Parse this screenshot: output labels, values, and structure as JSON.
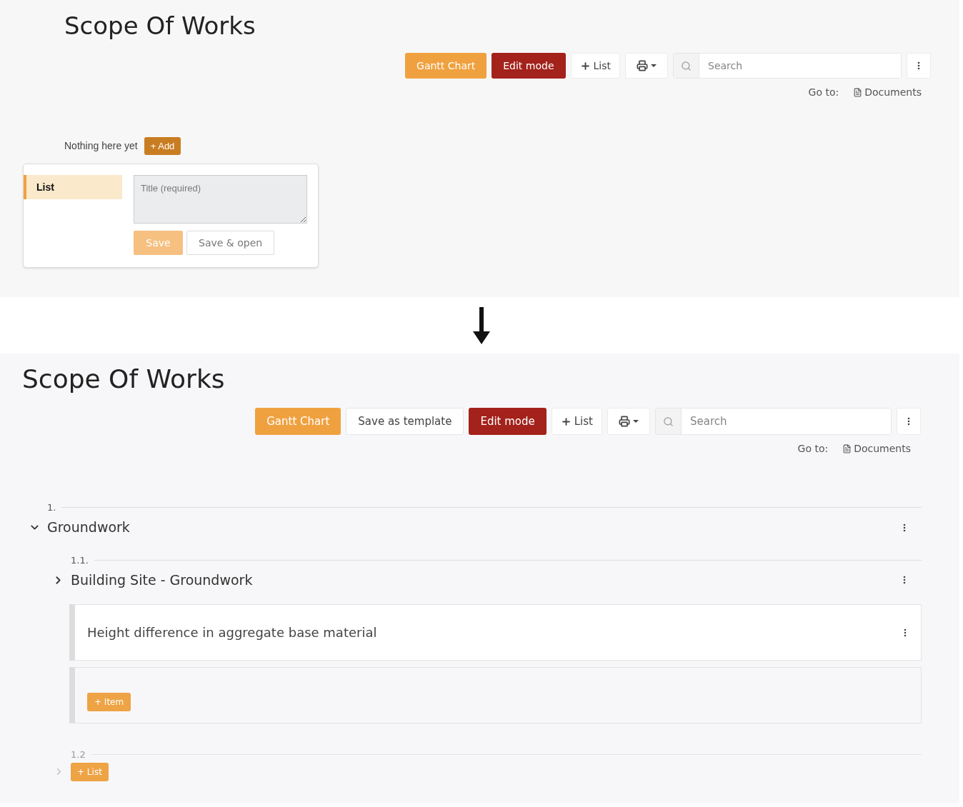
{
  "before": {
    "title": "Scope Of Works",
    "toolbar": [
      {
        "kind": "primary",
        "label": "Gantt Chart"
      },
      {
        "kind": "danger",
        "label": "Edit mode"
      },
      {
        "kind": "add",
        "label": "List"
      },
      {
        "kind": "print"
      },
      {
        "kind": "search",
        "placeholder": "Search"
      },
      {
        "kind": "more"
      }
    ],
    "goto": {
      "label": "Go to:",
      "link": "Documents"
    },
    "empty_text": "Nothing here yet",
    "add_button": "+ Add",
    "popover": {
      "types": [
        {
          "label": "List",
          "selected": true
        }
      ],
      "title_field": {
        "placeholder": "Title (required)"
      },
      "save_button": {
        "label": "Save",
        "disabled": true
      },
      "save_open_button": "Save & open"
    }
  },
  "after": {
    "title": "Scope Of Works",
    "toolbar": [
      {
        "kind": "primary",
        "label": "Gantt Chart"
      },
      {
        "kind": "default",
        "label": "Save as template"
      },
      {
        "kind": "danger",
        "label": "Edit mode"
      },
      {
        "kind": "add",
        "label": "List"
      },
      {
        "kind": "print"
      },
      {
        "kind": "search",
        "placeholder": "Search"
      },
      {
        "kind": "more"
      }
    ],
    "goto": {
      "label": "Go to:",
      "link": "Documents"
    },
    "tree": [
      {
        "number": "1.",
        "title": "Groundwork",
        "expanded": true,
        "children": [
          {
            "kind": "list",
            "number": "1.1.",
            "title": "Building Site - Groundwork",
            "expanded": false,
            "items": [
              "Height difference in aggregate base material"
            ],
            "add_item": "+ Item"
          },
          {
            "kind": "new",
            "number": "1.2",
            "button": "+ List"
          }
        ]
      }
    ]
  }
}
